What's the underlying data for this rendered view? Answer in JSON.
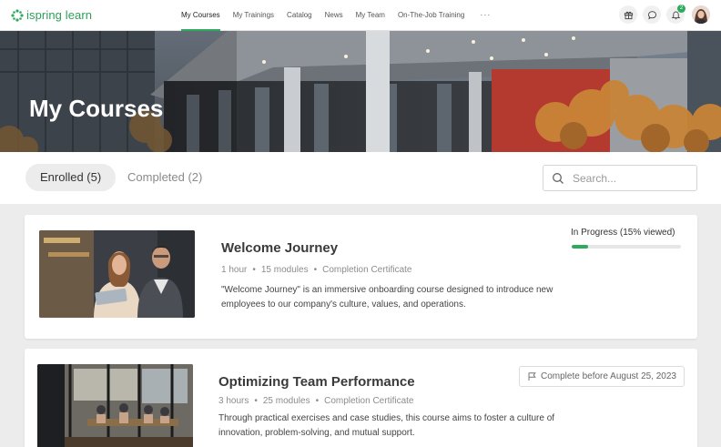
{
  "app": {
    "logo_text": "ispring learn",
    "brand_color": "#2eaa5e"
  },
  "nav": {
    "items": [
      {
        "label": "My Courses",
        "active": true
      },
      {
        "label": "My Trainings"
      },
      {
        "label": "Catalog"
      },
      {
        "label": "News"
      },
      {
        "label": "My Team"
      },
      {
        "label": "On-The-Job Training"
      }
    ],
    "more_label": "···"
  },
  "header_icons": {
    "gift": "gift-icon",
    "chat": "chat-icon",
    "bell": "bell-icon",
    "notification_count": "2"
  },
  "hero": {
    "title": "My Courses"
  },
  "tabs": {
    "enrolled": "Enrolled (5)",
    "completed": "Completed (2)"
  },
  "search": {
    "placeholder": "Search..."
  },
  "courses": [
    {
      "title": "Welcome Journey",
      "duration": "1 hour",
      "modules": "15 modules",
      "certificate": "Completion Certificate",
      "description": "\"Welcome Journey\" is an immersive onboarding course designed to introduce new employees to our company's culture, values, and operations.",
      "status": "In Progress (15% viewed)",
      "progress": 0.15
    },
    {
      "title": "Optimizing Team Performance",
      "duration": "3 hours",
      "modules": "25 modules",
      "certificate": "Completion Certificate",
      "description": "Through practical exercises and case studies, this course aims to foster a culture of innovation, problem-solving, and mutual support.",
      "deadline": "Complete before August 25, 2023"
    }
  ]
}
